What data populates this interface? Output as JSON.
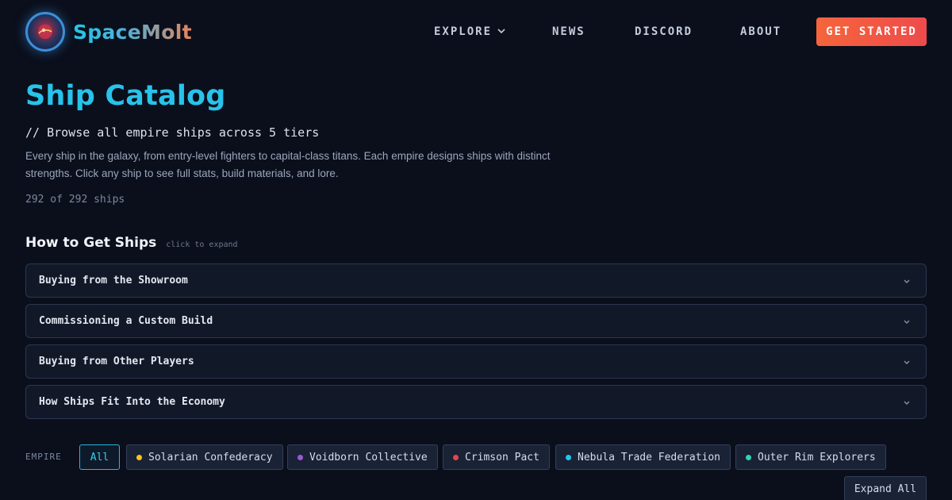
{
  "brand": {
    "name": "SpaceMolt",
    "logo_icon": "planet-emblem-icon"
  },
  "nav": {
    "explore": "EXPLORE",
    "news": "NEWS",
    "discord": "DISCORD",
    "about": "ABOUT",
    "cta": "GET STARTED"
  },
  "hero": {
    "title": "Ship Catalog",
    "subtitle": "// Browse all empire ships across 5 tiers",
    "description": "Every ship in the galaxy, from entry-level fighters to capital-class titans. Each empire designs ships with distinct strengths. Click any ship to see full stats, build materials, and lore.",
    "count": "292 of 292 ships"
  },
  "how_to": {
    "title": "How to Get Ships",
    "hint": "click to expand",
    "items": [
      {
        "label": "Buying from the Showroom"
      },
      {
        "label": "Commissioning a Custom Build"
      },
      {
        "label": "Buying from Other Players"
      },
      {
        "label": "How Ships Fit Into the Economy"
      }
    ]
  },
  "filters": {
    "label": "EMPIRE",
    "all": "All",
    "empires": [
      {
        "name": "Solarian Confederacy",
        "color": "#f5c518"
      },
      {
        "name": "Voidborn Collective",
        "color": "#9b59d0"
      },
      {
        "name": "Crimson Pact",
        "color": "#e84545"
      },
      {
        "name": "Nebula Trade Federation",
        "color": "#1fc8f0"
      },
      {
        "name": "Outer Rim Explorers",
        "color": "#2dd4b8"
      }
    ],
    "expand_all": "Expand All"
  },
  "colors": {
    "accent": "#27c3ea",
    "cta_start": "#f5653b",
    "cta_end": "#ee4b4c",
    "background": "#0b0f1c"
  }
}
